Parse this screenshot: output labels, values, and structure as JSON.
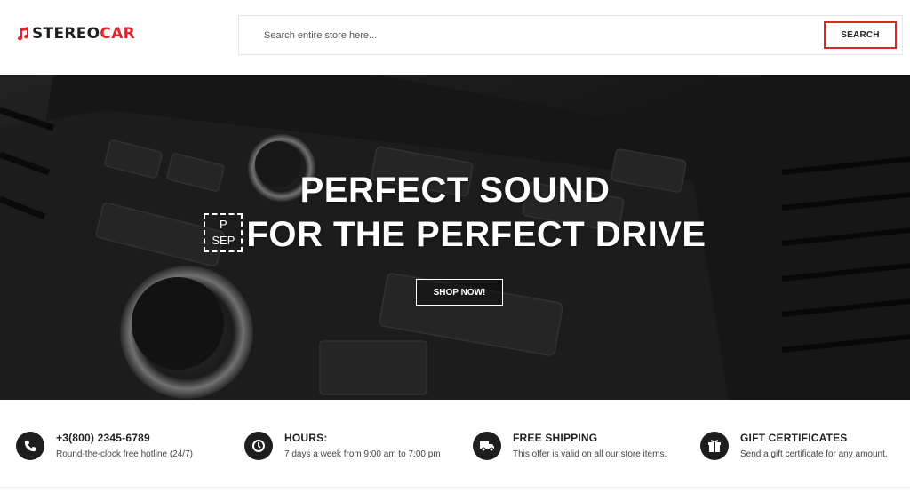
{
  "brand": {
    "name_a": "STEREO",
    "name_b": "CAR",
    "accent": "#e0242b"
  },
  "search": {
    "placeholder": "Search entire store here...",
    "button_label": "SEARCH"
  },
  "hero": {
    "title_line1": "PERFECT SOUND",
    "sep_top": "P",
    "sep_bottom": "SEP",
    "title_line2": "FOR THE PERFECT DRIVE",
    "cta_label": "SHOP NOW!"
  },
  "features": [
    {
      "icon": "phone-icon",
      "title": "+3(800) 2345-6789",
      "text": "Round-the-clock free hotline (24/7)"
    },
    {
      "icon": "clock-icon",
      "title": "HOURS:",
      "text": "7 days a week from 9:00 am to 7:00 pm"
    },
    {
      "icon": "truck-icon",
      "title": "FREE SHIPPING",
      "text": "This offer is valid on all our store items."
    },
    {
      "icon": "gift-icon",
      "title": "GIFT CERTIFICATES",
      "text": "Send a gift certificate for any amount."
    }
  ]
}
